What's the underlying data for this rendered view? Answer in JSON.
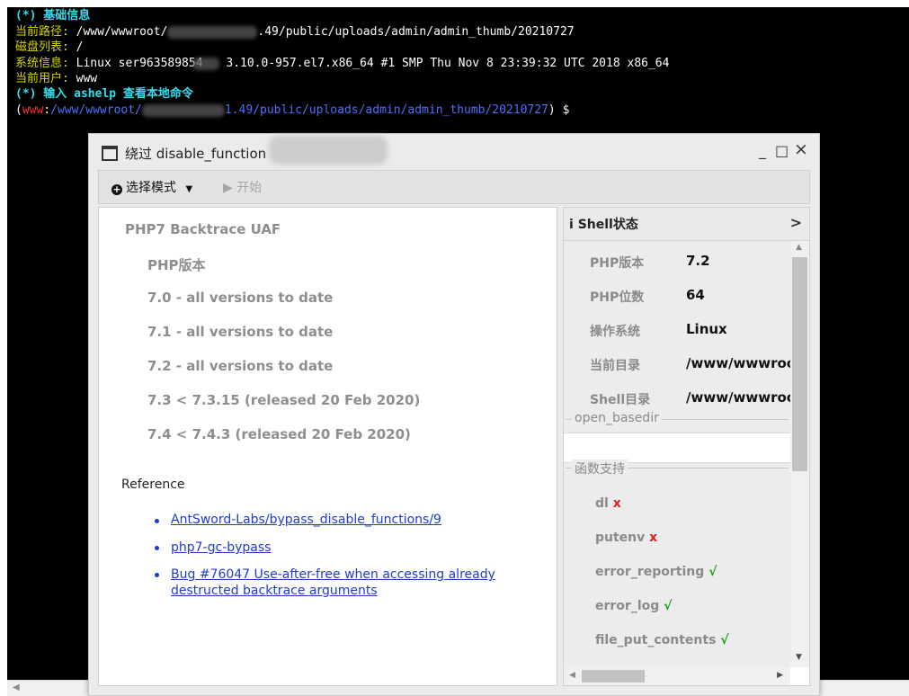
{
  "terminal": {
    "line1": "(*) 基础信息",
    "path_label": "当前路径:",
    "path_prefix": " /www/wwwroot/",
    "path_suffix": ".49/public/uploads/admin/admin_thumb/20210727",
    "disk_label": "磁盘列表:",
    "disk_value": " /",
    "sys_label": "系统信息:",
    "sys_prefix": " Linux ser963589854",
    "sys_suffix": " 3.10.0-957.el7.x86_64 #1 SMP Thu Nov 8 23:39:32 UTC 2018 x86_64",
    "user_label": "当前用户:",
    "user_value": " www",
    "help_line": "(*) 输入 ashelp 查看本地命令",
    "prompt_open": "(",
    "prompt_user": "www",
    "prompt_colon": ":",
    "prompt_path_prefix": "/www/wwwroot/",
    "prompt_path_suffix": "1.49/public/uploads/admin/admin_thumb/20210727",
    "prompt_close": ") $"
  },
  "dialog": {
    "title": "绕过 disable_function",
    "minimize": "_",
    "maximize": "□",
    "close": "×"
  },
  "toolbar": {
    "mode_icon": "+",
    "mode_label": "选择模式",
    "mode_caret": "▼",
    "start_label": "▶ 开始"
  },
  "left_panel": {
    "heading": "PHP7 Backtrace UAF",
    "php_version_label": "PHP版本",
    "versions": [
      "7.0 - all versions to date",
      "7.1 - all versions to date",
      "7.2 - all versions to date",
      "7.3 < 7.3.15 (released 20 Feb 2020)",
      "7.4 < 7.4.3 (released 20 Feb 2020)"
    ],
    "reference_title": "Reference",
    "references": [
      "AntSword-Labs/bypass_disable_functions/9",
      "php7-gc-bypass",
      "Bug #76047 Use-after-free when accessing already destructed backtrace arguments"
    ]
  },
  "shell_status": {
    "icon": "i",
    "title": "Shell状态",
    "chevron": ">",
    "info": [
      {
        "key": "PHP版本",
        "value": "7.2"
      },
      {
        "key": "PHP位数",
        "value": "64"
      },
      {
        "key": "操作系统",
        "value": "Linux"
      },
      {
        "key": "当前目录",
        "value": "/www/wwwroot"
      },
      {
        "key": "Shell目录",
        "value": "/www/wwwroot"
      }
    ],
    "open_basedir_label": "open_basedir",
    "functions_label": "函数支持",
    "functions": [
      {
        "name": "dl",
        "mark": "x"
      },
      {
        "name": "putenv",
        "mark": "x"
      },
      {
        "name": "error_reporting",
        "mark": "√"
      },
      {
        "name": "error_log",
        "mark": "√"
      },
      {
        "name": "file_put_contents",
        "mark": "√"
      }
    ]
  },
  "colors": {
    "terminal_bg": "#000000",
    "label_yellow": "#d7d700",
    "cyan": "#33ddee",
    "prompt_red": "#ff3030",
    "prompt_blue": "#4f6fff",
    "link": "#1f3ccc",
    "cross": "#e02020",
    "check": "#1b9e1b"
  }
}
